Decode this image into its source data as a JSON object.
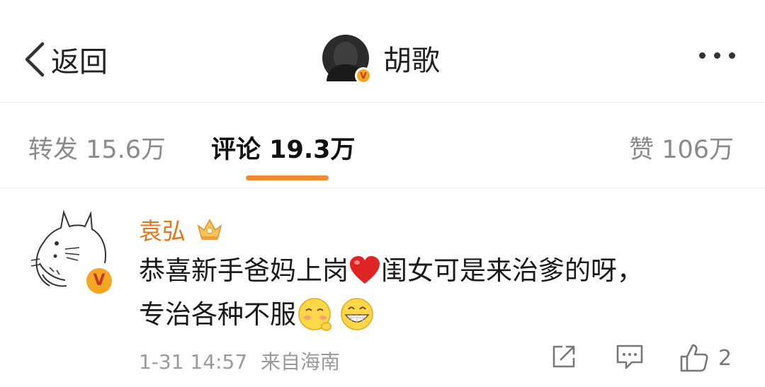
{
  "header": {
    "back_label": "返回",
    "title": "胡歌"
  },
  "tabs": [
    {
      "label": "转发 15.6万",
      "active": false
    },
    {
      "label": "评论 19.3万",
      "active": true
    },
    {
      "label": "赞 106万",
      "active": false
    }
  ],
  "comment": {
    "author": "袁弘",
    "text_line1_a": "恭喜新手爸妈上岗",
    "text_line1_b": "闺女可是来治爹的呀，",
    "text_line2": "专治各种不服",
    "timestamp": "1-31 14:57",
    "source": "来自海南",
    "like_count": "2"
  },
  "colors": {
    "accent": "#f08a2c",
    "name": "#e0781e",
    "verified": "#f5a623"
  },
  "icons": [
    "back-chevron-icon",
    "more-icon",
    "verified-icon",
    "vip-crown-icon",
    "heart-emoji-icon",
    "shy-emoji-icon",
    "grin-emoji-icon",
    "share-icon",
    "reply-icon",
    "thumbs-up-icon"
  ]
}
